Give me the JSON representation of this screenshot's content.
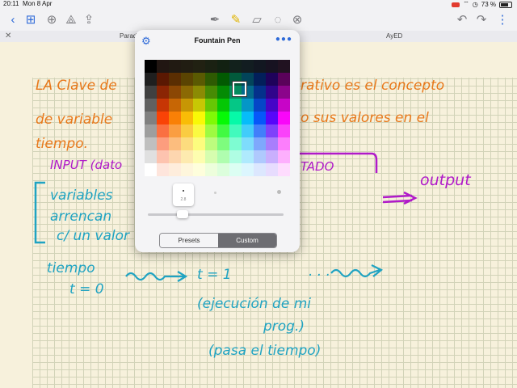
{
  "status_bar": {
    "time": "20:11",
    "date": "Mon 8 Apr",
    "battery": "73 %"
  },
  "tabs": {
    "left": "Parad",
    "right": "AyED"
  },
  "popup": {
    "title": "Fountain Pen",
    "size_value": "2.8",
    "segments": [
      "Presets",
      "Custom"
    ],
    "selected_segment": "Custom"
  },
  "notes": {
    "line1": "LA Clave de",
    "line1b": "rativo es el concepto",
    "line2": "de variable",
    "line2b": "o sus valores en el",
    "line3": "tiempo.",
    "input": "INPUT (dato",
    "tado": "TADO",
    "output": "output",
    "var1": "variables",
    "var2": "arrencan",
    "var3": "c/ un valor",
    "tiempo": "tiempo",
    "t0": "t = 0",
    "t1": "t = 1",
    "dots": ". . .",
    "exec1": "(ejecución de mi",
    "exec2": "prog.)",
    "exec3": "(pasa el tiempo)"
  },
  "colors": {
    "orange": "#e8781a",
    "purple": "#b01ac9",
    "teal": "#1fa3c2",
    "accent": "#2e6ad8"
  }
}
